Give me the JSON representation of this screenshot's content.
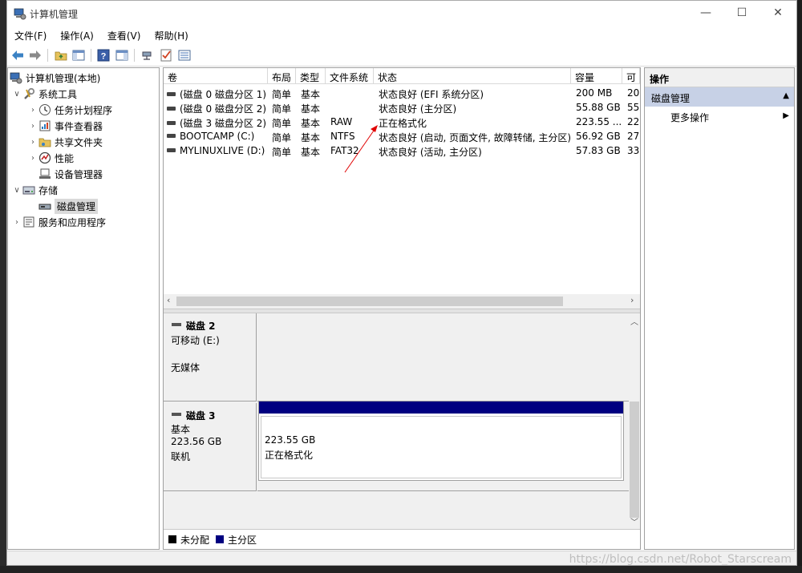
{
  "window": {
    "title": "计算机管理",
    "minimize": "—",
    "maximize": "☐",
    "close": "✕"
  },
  "menu": [
    "文件(F)",
    "操作(A)",
    "查看(V)",
    "帮助(H)"
  ],
  "tree": {
    "root": "计算机管理(本地)",
    "system_tools": "系统工具",
    "task_scheduler": "任务计划程序",
    "event_viewer": "事件查看器",
    "shared_folders": "共享文件夹",
    "performance": "性能",
    "device_manager": "设备管理器",
    "storage": "存储",
    "disk_management": "磁盘管理",
    "services_apps": "服务和应用程序"
  },
  "volumes": {
    "columns": [
      "卷",
      "布局",
      "类型",
      "文件系统",
      "状态",
      "容量",
      "可"
    ],
    "rows": [
      [
        "(磁盘 0 磁盘分区 1)",
        "简单",
        "基本",
        "",
        "状态良好 (EFI 系统分区)",
        "200 MB",
        "20"
      ],
      [
        "(磁盘 0 磁盘分区 2)",
        "简单",
        "基本",
        "",
        "状态良好 (主分区)",
        "55.88 GB",
        "55"
      ],
      [
        "(磁盘 3 磁盘分区 2)",
        "简单",
        "基本",
        "RAW",
        "正在格式化",
        "223.55 ...",
        "22"
      ],
      [
        "BOOTCAMP (C:)",
        "简单",
        "基本",
        "NTFS",
        "状态良好 (启动, 页面文件, 故障转储, 主分区)",
        "56.92 GB",
        "27"
      ],
      [
        "MYLINUXLIVE (D:)",
        "简单",
        "基本",
        "FAT32",
        "状态良好 (活动, 主分区)",
        "57.83 GB",
        "33"
      ]
    ]
  },
  "disks": {
    "disk2": {
      "name": "磁盘 2",
      "type": "可移动 (E:)",
      "media": "无媒体"
    },
    "disk3": {
      "name": "磁盘 3",
      "type": "基本",
      "size": "223.56 GB",
      "state": "联机",
      "partition_size": "223.55 GB",
      "partition_status": "正在格式化"
    }
  },
  "legend": [
    {
      "label": "未分配",
      "color": "#000000"
    },
    {
      "label": "主分区",
      "color": "#000080"
    }
  ],
  "actions": {
    "header": "操作",
    "section": "磁盘管理",
    "more": "更多操作"
  },
  "watermark": "https://blog.csdn.net/Robot_Starscream",
  "colors": {
    "primary_partition": "#000080",
    "selected_section": "#c7d1e6",
    "annotation_arrow": "#e00000"
  }
}
